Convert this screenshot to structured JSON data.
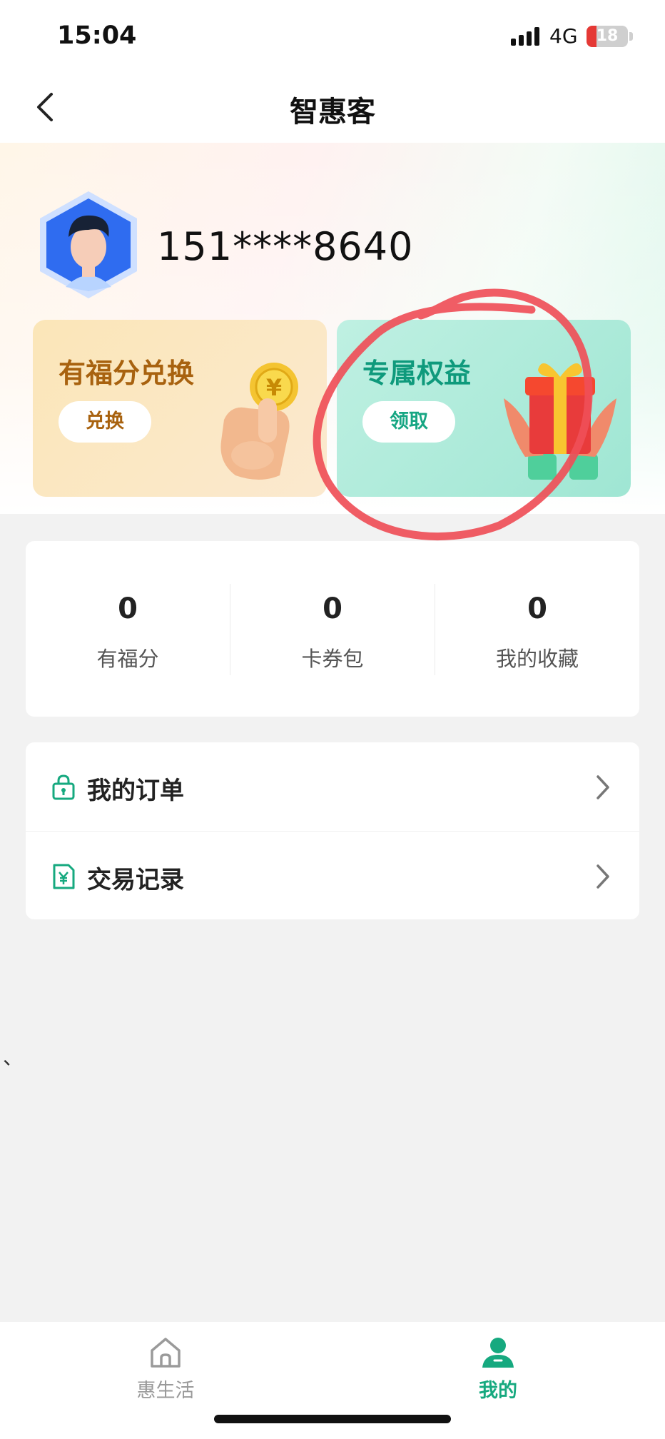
{
  "status_bar": {
    "time": "15:04",
    "network": "4G",
    "battery": "18"
  },
  "nav": {
    "title": "智惠客"
  },
  "profile": {
    "phone": "151****8640"
  },
  "cards": {
    "points": {
      "title": "有福分兑换",
      "button": "兑换"
    },
    "benefits": {
      "title": "专属权益",
      "button": "领取"
    }
  },
  "stats": [
    {
      "value": "0",
      "label": "有福分"
    },
    {
      "value": "0",
      "label": "卡券包"
    },
    {
      "value": "0",
      "label": "我的收藏"
    }
  ],
  "menu": [
    {
      "label": "我的订单",
      "icon": "lock-bag-icon"
    },
    {
      "label": "交易记录",
      "icon": "yuan-document-icon"
    }
  ],
  "stray_mark": "、",
  "tabbar": {
    "home": {
      "label": "惠生活",
      "icon": "home-icon"
    },
    "mine": {
      "label": "我的",
      "icon": "person-icon"
    }
  },
  "colors": {
    "accent": "#16a97f",
    "points_title": "#a8620f",
    "annotation": "#ef4f58"
  }
}
